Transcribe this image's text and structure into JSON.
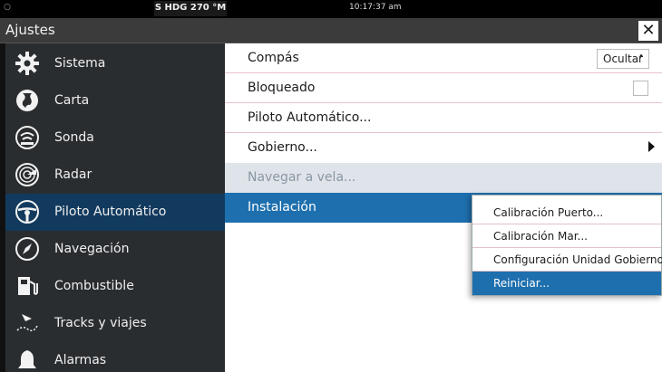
{
  "status_bar": {
    "left_text": "○",
    "heading": "S HDG 270 °M",
    "clock": "10:17:37 am"
  },
  "window": {
    "title": "Ajustes",
    "close_label": "✕"
  },
  "sidebar": {
    "items": [
      {
        "label": "Sistema",
        "icon": "gear-icon"
      },
      {
        "label": "Carta",
        "icon": "globe-icon"
      },
      {
        "label": "Sonda",
        "icon": "sonar-icon"
      },
      {
        "label": "Radar",
        "icon": "radar-icon"
      },
      {
        "label": "Piloto Automático",
        "icon": "helm-wheel-icon",
        "active": true
      },
      {
        "label": "Navegación",
        "icon": "compass-icon"
      },
      {
        "label": "Combustible",
        "icon": "fuel-pump-icon"
      },
      {
        "label": "Tracks y viajes",
        "icon": "track-icon"
      },
      {
        "label": "Alarmas",
        "icon": "bell-icon"
      }
    ]
  },
  "main": {
    "rows": [
      {
        "label": "Compás",
        "control": "select",
        "value": "Ocultar"
      },
      {
        "label": "Bloqueado",
        "control": "checkbox",
        "checked": false
      },
      {
        "label": "Piloto Automático..."
      },
      {
        "label": "Gobierno...",
        "control": "submenu-arrow"
      },
      {
        "label": "Navegar a vela...",
        "disabled": true
      },
      {
        "label": "Instalación",
        "selected": true
      }
    ]
  },
  "submenu": {
    "items": [
      {
        "label": "Calibración Puerto..."
      },
      {
        "label": "Calibración Mar..."
      },
      {
        "label": "Configuración Unidad Gobierno..."
      },
      {
        "label": "Reiniciar...",
        "highlighted": true
      }
    ]
  },
  "colors": {
    "accent": "#1e6fae",
    "sidebar_bg": "#2a2d30",
    "sidebar_active": "#123a5e",
    "title_bar": "#3b3b3b"
  }
}
